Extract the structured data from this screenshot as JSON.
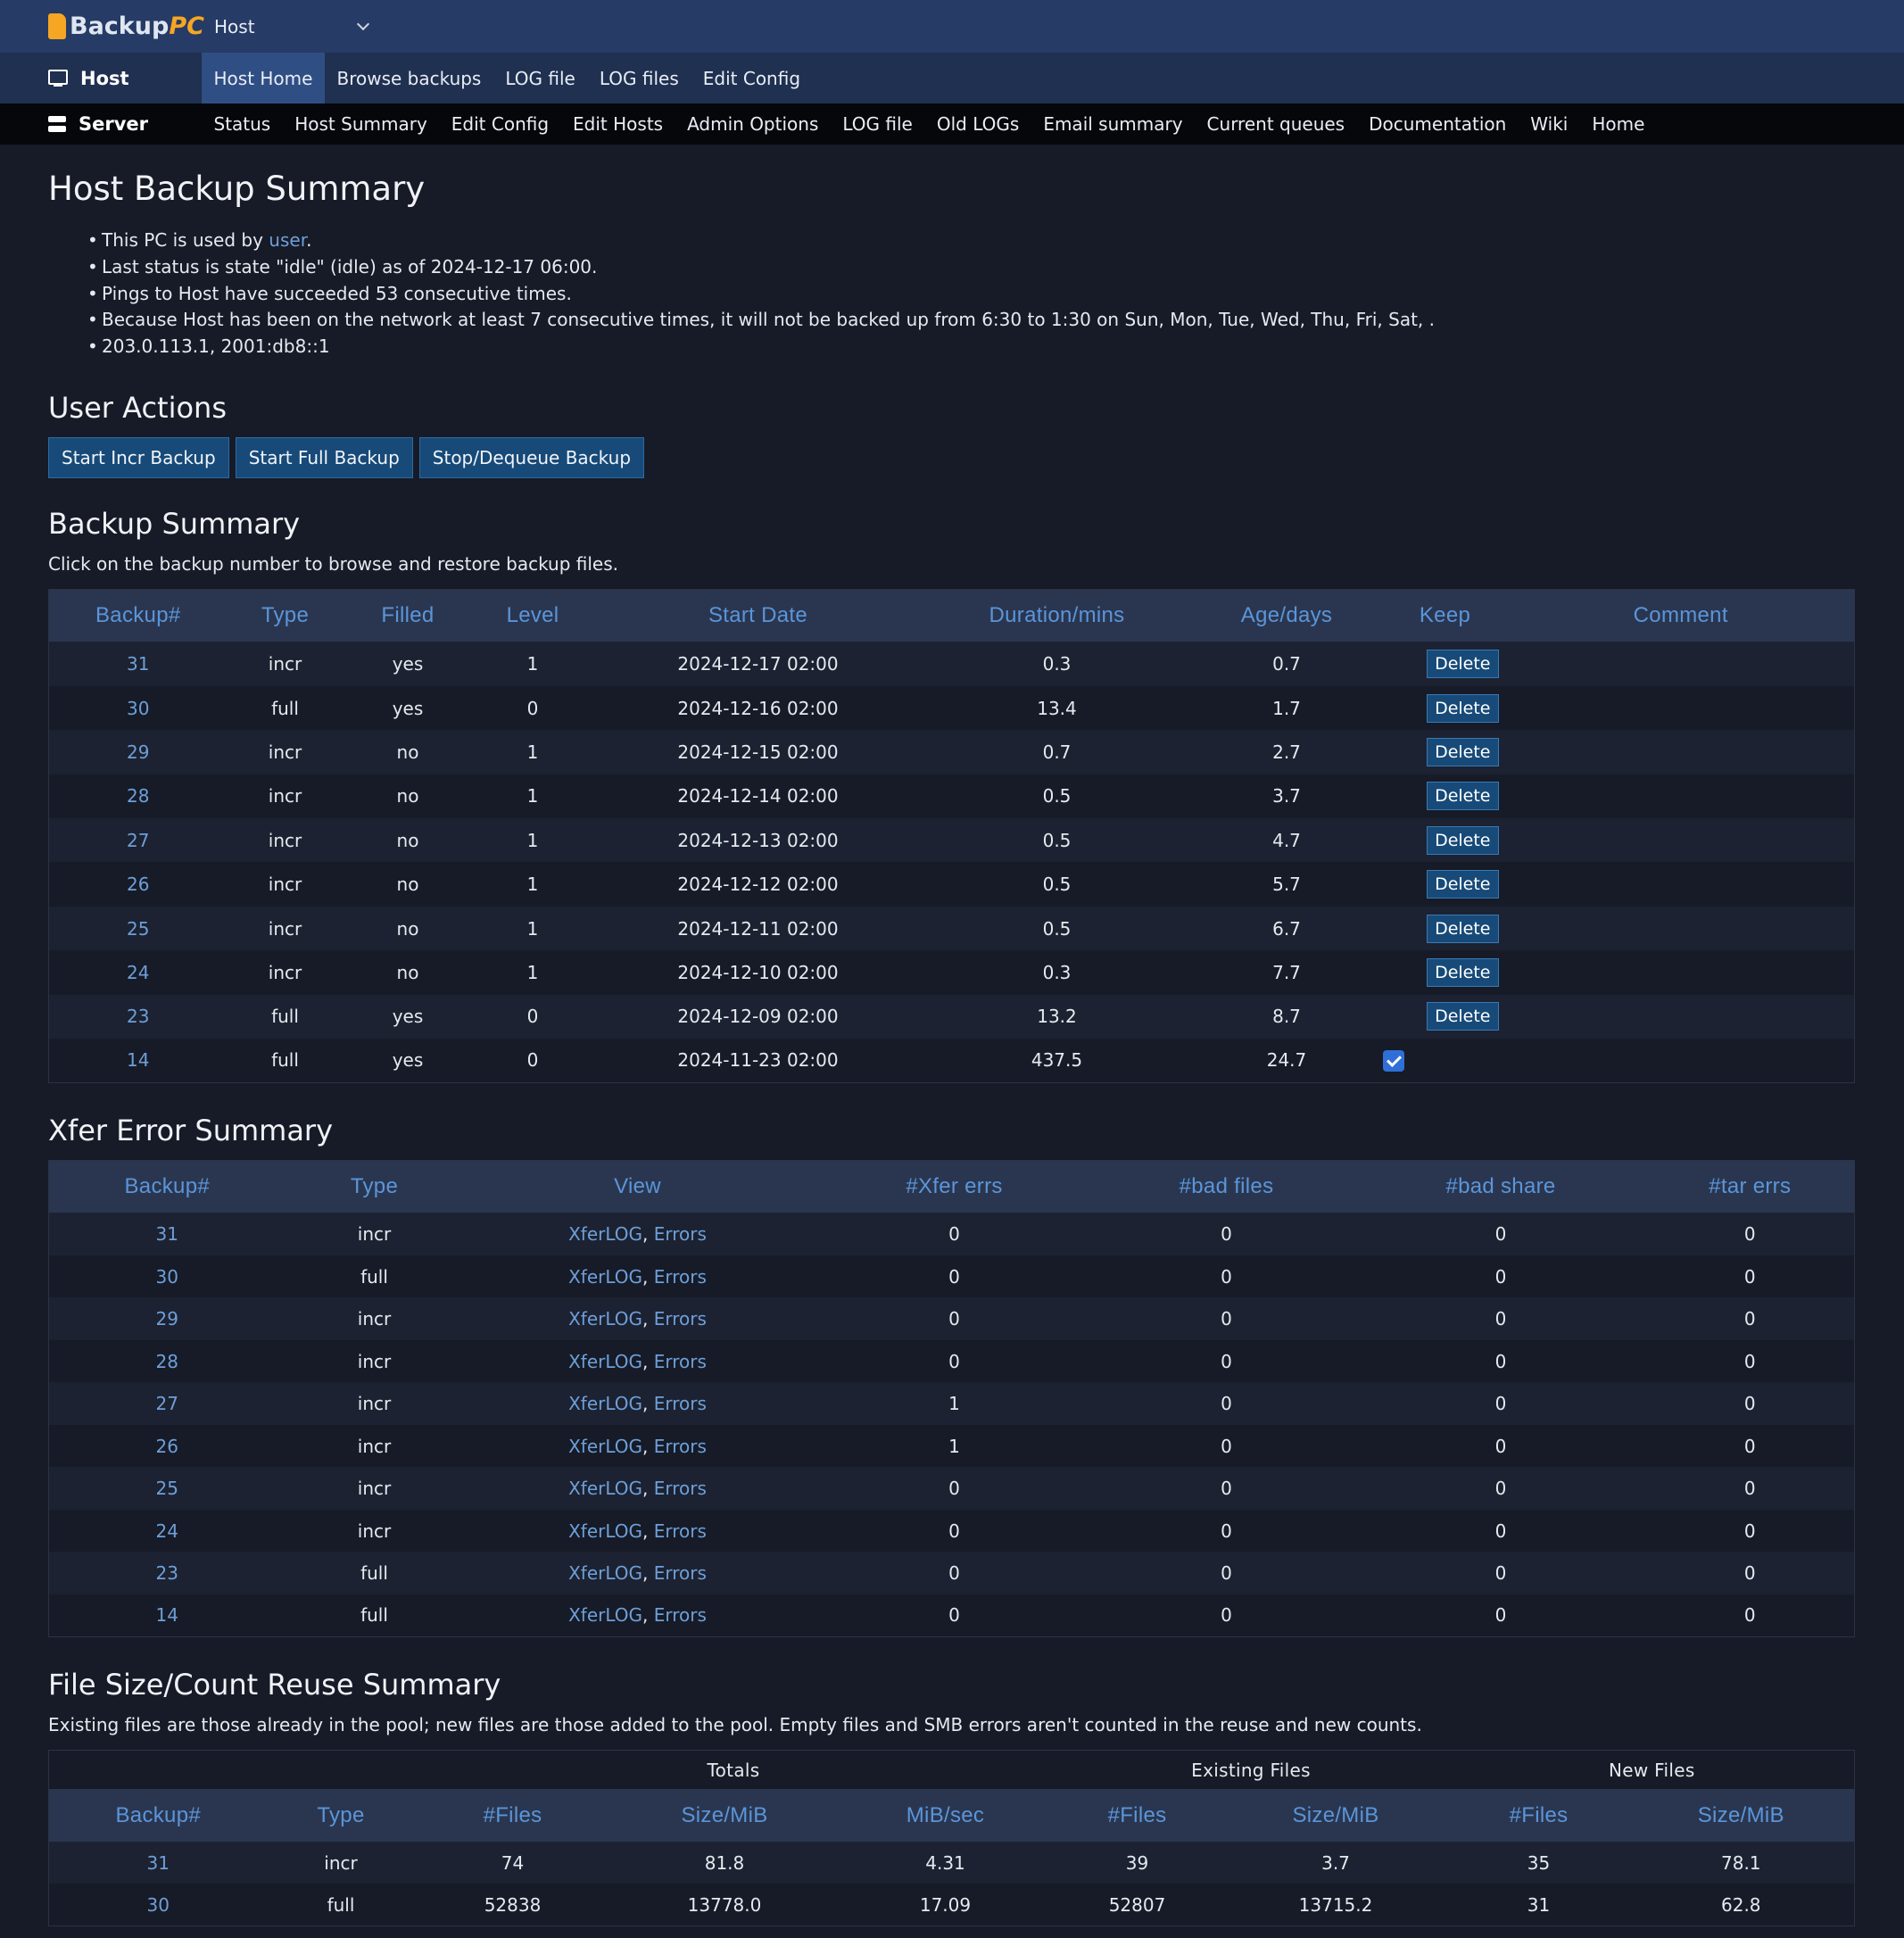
{
  "brand": {
    "name_a": "Backup",
    "name_b": "PC"
  },
  "host_select": {
    "value": "Host"
  },
  "hostbar": {
    "title": "Host",
    "items": [
      {
        "label": "Host Home",
        "active": true
      },
      {
        "label": "Browse backups"
      },
      {
        "label": "LOG file"
      },
      {
        "label": "LOG files"
      },
      {
        "label": "Edit Config"
      }
    ]
  },
  "serverbar": {
    "title": "Server",
    "items": [
      {
        "label": "Status"
      },
      {
        "label": "Host Summary"
      },
      {
        "label": "Edit Config"
      },
      {
        "label": "Edit Hosts"
      },
      {
        "label": "Admin Options"
      },
      {
        "label": "LOG file"
      },
      {
        "label": "Old LOGs"
      },
      {
        "label": "Email summary"
      },
      {
        "label": "Current queues"
      },
      {
        "label": "Documentation"
      },
      {
        "label": "Wiki"
      },
      {
        "label": "Home"
      }
    ]
  },
  "page_title": "Host Backup Summary",
  "info": {
    "line1_prefix": "This PC is used by ",
    "line1_link": "user",
    "line1_suffix": ".",
    "line2": "Last status is state \"idle\" (idle) as of 2024-12-17 06:00.",
    "line3": "Pings to Host have succeeded 53 consecutive times.",
    "line4": "Because Host has been on the network at least 7 consecutive times, it will not be backed up from 6:30 to 1:30 on Sun, Mon, Tue, Wed, Thu, Fri, Sat, .",
    "line5": "203.0.113.1, 2001:db8::1"
  },
  "user_actions": {
    "heading": "User Actions",
    "incr": "Start Incr Backup",
    "full": "Start Full Backup",
    "stop": "Stop/Dequeue Backup"
  },
  "backup_summary": {
    "heading": "Backup Summary",
    "note": "Click on the backup number to browse and restore backup files.",
    "columns": [
      "Backup#",
      "Type",
      "Filled",
      "Level",
      "Start Date",
      "Duration/mins",
      "Age/days",
      "Keep",
      "Comment"
    ],
    "delete_label": "Delete",
    "rows": [
      {
        "num": "31",
        "type": "incr",
        "filled": "yes",
        "level": "1",
        "start": "2024-12-17 02:00",
        "dur": "0.3",
        "age": "0.7",
        "keep": false
      },
      {
        "num": "30",
        "type": "full",
        "filled": "yes",
        "level": "0",
        "start": "2024-12-16 02:00",
        "dur": "13.4",
        "age": "1.7",
        "keep": false
      },
      {
        "num": "29",
        "type": "incr",
        "filled": "no",
        "level": "1",
        "start": "2024-12-15 02:00",
        "dur": "0.7",
        "age": "2.7",
        "keep": false
      },
      {
        "num": "28",
        "type": "incr",
        "filled": "no",
        "level": "1",
        "start": "2024-12-14 02:00",
        "dur": "0.5",
        "age": "3.7",
        "keep": false
      },
      {
        "num": "27",
        "type": "incr",
        "filled": "no",
        "level": "1",
        "start": "2024-12-13 02:00",
        "dur": "0.5",
        "age": "4.7",
        "keep": false
      },
      {
        "num": "26",
        "type": "incr",
        "filled": "no",
        "level": "1",
        "start": "2024-12-12 02:00",
        "dur": "0.5",
        "age": "5.7",
        "keep": false
      },
      {
        "num": "25",
        "type": "incr",
        "filled": "no",
        "level": "1",
        "start": "2024-12-11 02:00",
        "dur": "0.5",
        "age": "6.7",
        "keep": false
      },
      {
        "num": "24",
        "type": "incr",
        "filled": "no",
        "level": "1",
        "start": "2024-12-10 02:00",
        "dur": "0.3",
        "age": "7.7",
        "keep": false
      },
      {
        "num": "23",
        "type": "full",
        "filled": "yes",
        "level": "0",
        "start": "2024-12-09 02:00",
        "dur": "13.2",
        "age": "8.7",
        "keep": false
      },
      {
        "num": "14",
        "type": "full",
        "filled": "yes",
        "level": "0",
        "start": "2024-11-23 02:00",
        "dur": "437.5",
        "age": "24.7",
        "keep": true
      }
    ]
  },
  "xfer_errors": {
    "heading": "Xfer Error Summary",
    "columns": [
      "Backup#",
      "Type",
      "View",
      "#Xfer errs",
      "#bad files",
      "#bad share",
      "#tar errs"
    ],
    "view_log": "XferLOG",
    "view_sep": ", ",
    "view_err": "Errors",
    "rows": [
      {
        "num": "31",
        "type": "incr",
        "xfer": "0",
        "badf": "0",
        "bads": "0",
        "tar": "0"
      },
      {
        "num": "30",
        "type": "full",
        "xfer": "0",
        "badf": "0",
        "bads": "0",
        "tar": "0"
      },
      {
        "num": "29",
        "type": "incr",
        "xfer": "0",
        "badf": "0",
        "bads": "0",
        "tar": "0"
      },
      {
        "num": "28",
        "type": "incr",
        "xfer": "0",
        "badf": "0",
        "bads": "0",
        "tar": "0"
      },
      {
        "num": "27",
        "type": "incr",
        "xfer": "1",
        "badf": "0",
        "bads": "0",
        "tar": "0"
      },
      {
        "num": "26",
        "type": "incr",
        "xfer": "1",
        "badf": "0",
        "bads": "0",
        "tar": "0"
      },
      {
        "num": "25",
        "type": "incr",
        "xfer": "0",
        "badf": "0",
        "bads": "0",
        "tar": "0"
      },
      {
        "num": "24",
        "type": "incr",
        "xfer": "0",
        "badf": "0",
        "bads": "0",
        "tar": "0"
      },
      {
        "num": "23",
        "type": "full",
        "xfer": "0",
        "badf": "0",
        "bads": "0",
        "tar": "0"
      },
      {
        "num": "14",
        "type": "full",
        "xfer": "0",
        "badf": "0",
        "bads": "0",
        "tar": "0"
      }
    ]
  },
  "reuse": {
    "heading": "File Size/Count Reuse Summary",
    "note": "Existing files are those already in the pool; new files are those added to the pool. Empty files and SMB errors aren't counted in the reuse and new counts.",
    "groups": {
      "totals": "Totals",
      "existing": "Existing Files",
      "new": "New Files"
    },
    "columns": [
      "Backup#",
      "Type",
      "#Files",
      "Size/MiB",
      "MiB/sec",
      "#Files",
      "Size/MiB",
      "#Files",
      "Size/MiB"
    ],
    "rows": [
      {
        "num": "31",
        "type": "incr",
        "files": "74",
        "size": "81.8",
        "rate": "4.31",
        "efiles": "39",
        "esize": "3.7",
        "nfiles": "35",
        "nsize": "78.1"
      },
      {
        "num": "30",
        "type": "full",
        "files": "52838",
        "size": "13778.0",
        "rate": "17.09",
        "efiles": "52807",
        "esize": "13715.2",
        "nfiles": "31",
        "nsize": "62.8"
      }
    ]
  }
}
